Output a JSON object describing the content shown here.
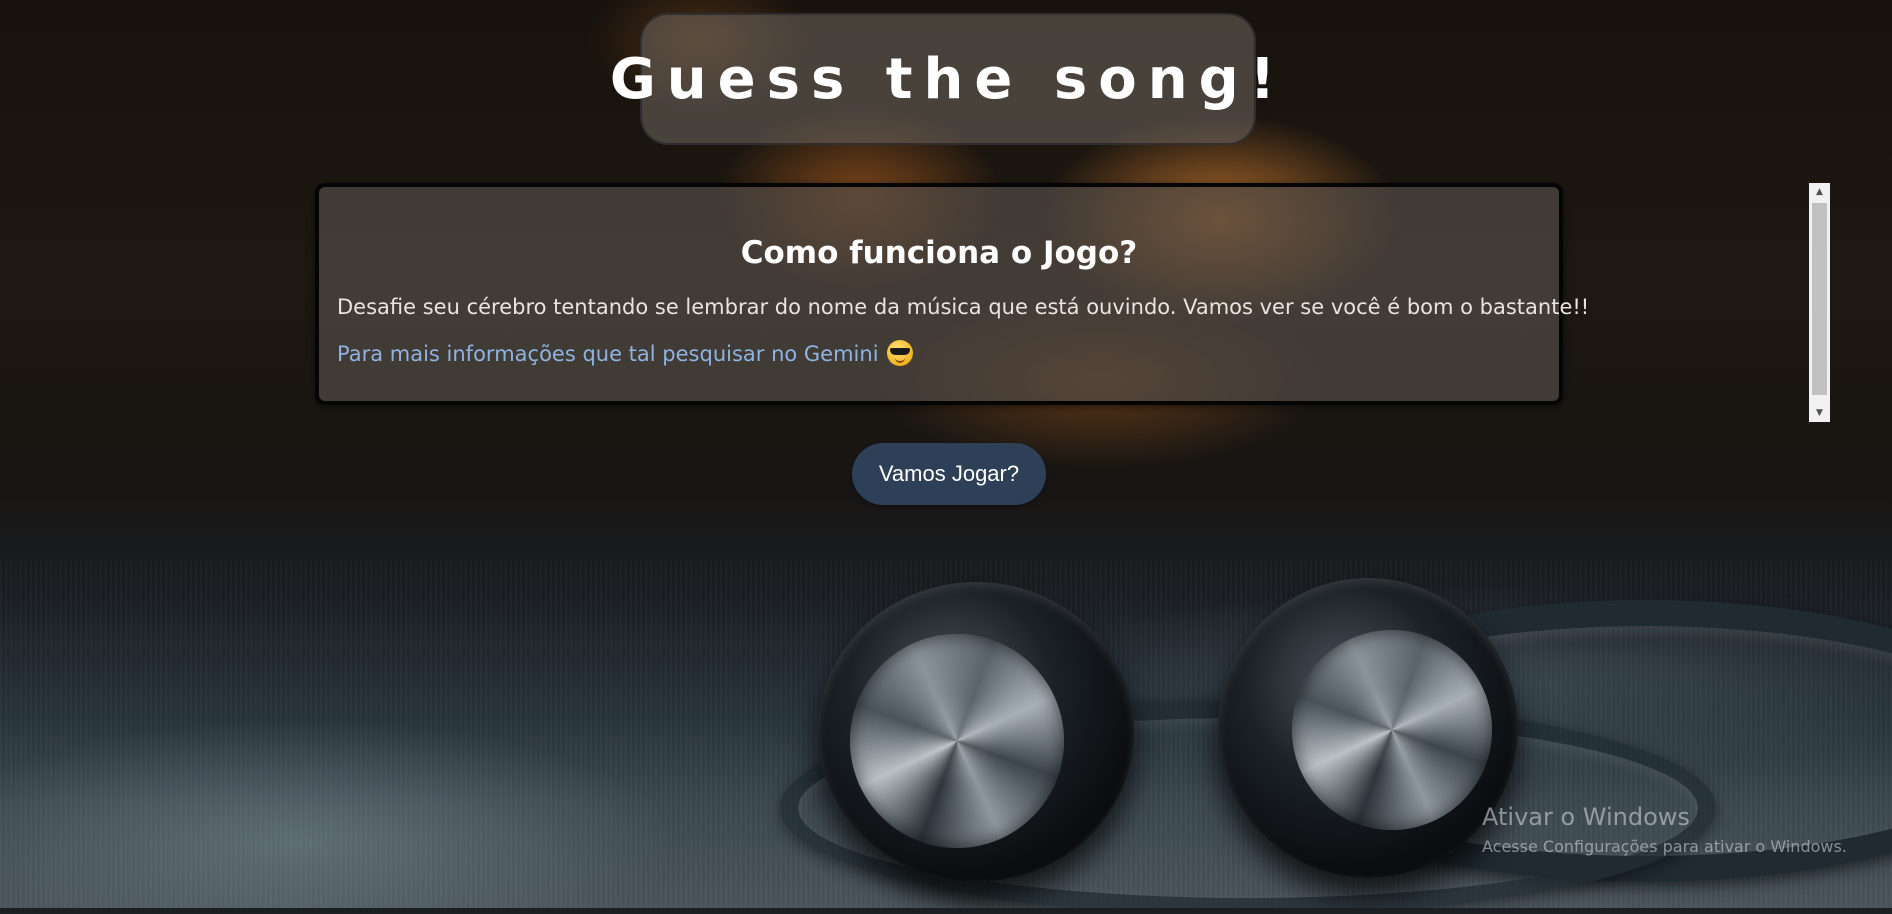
{
  "page": {
    "title": "Guess the song!"
  },
  "info_panel": {
    "heading": "Como funciona o Jogo?",
    "description": "Desafie seu cérebro tentando se lembrar do nome da música que está ouvindo. Vamos ver se você é bom o bastante!!",
    "link_text": "Para mais informações que tal pesquisar no Gemini",
    "link_emoji_icon": "smiling-face-with-sunglasses-icon"
  },
  "play_button": {
    "label": "Vamos Jogar?",
    "background_color": "#2e4057"
  },
  "scrollbar": {
    "up_arrow": "▲",
    "down_arrow": "▼"
  },
  "windows_watermark": {
    "line1": "Ativar o Windows",
    "line2": "Acesse Configurações para ativar o Windows."
  },
  "colors": {
    "link": "#8fb3e0",
    "panel_border": "#050505",
    "title_text": "#ffffff"
  }
}
